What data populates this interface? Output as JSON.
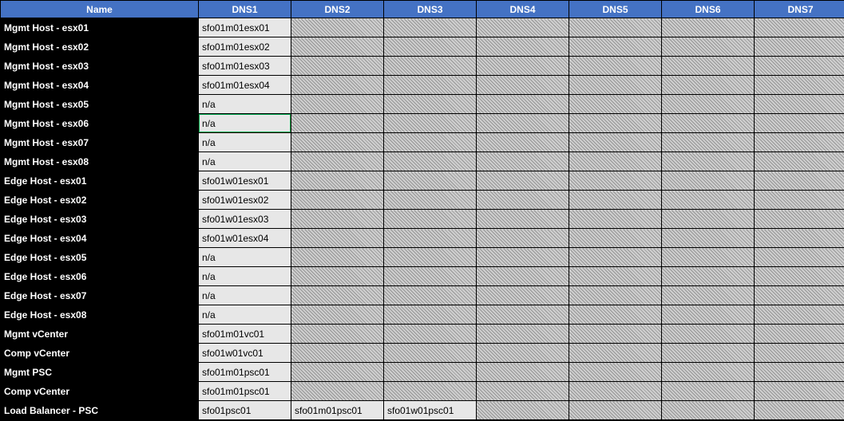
{
  "headers": {
    "name": "Name",
    "dns1": "DNS1",
    "dns2": "DNS2",
    "dns3": "DNS3",
    "dns4": "DNS4",
    "dns5": "DNS5",
    "dns6": "DNS6",
    "dns7": "DNS7"
  },
  "rows": [
    {
      "name": "Mgmt Host - esx01",
      "dns": [
        "sfo01m01esx01",
        null,
        null,
        null,
        null,
        null,
        null
      ]
    },
    {
      "name": "Mgmt Host - esx02",
      "dns": [
        "sfo01m01esx02",
        null,
        null,
        null,
        null,
        null,
        null
      ]
    },
    {
      "name": "Mgmt Host - esx03",
      "dns": [
        "sfo01m01esx03",
        null,
        null,
        null,
        null,
        null,
        null
      ]
    },
    {
      "name": "Mgmt Host - esx04",
      "dns": [
        "sfo01m01esx04",
        null,
        null,
        null,
        null,
        null,
        null
      ]
    },
    {
      "name": "Mgmt Host - esx05",
      "dns": [
        "n/a",
        null,
        null,
        null,
        null,
        null,
        null
      ]
    },
    {
      "name": "Mgmt Host - esx06",
      "dns": [
        "n/a",
        null,
        null,
        null,
        null,
        null,
        null
      ],
      "selected": 0
    },
    {
      "name": "Mgmt Host - esx07",
      "dns": [
        "n/a",
        null,
        null,
        null,
        null,
        null,
        null
      ]
    },
    {
      "name": "Mgmt Host - esx08",
      "dns": [
        "n/a",
        null,
        null,
        null,
        null,
        null,
        null
      ]
    },
    {
      "name": "Edge Host - esx01",
      "dns": [
        "sfo01w01esx01",
        null,
        null,
        null,
        null,
        null,
        null
      ]
    },
    {
      "name": "Edge Host - esx02",
      "dns": [
        "sfo01w01esx02",
        null,
        null,
        null,
        null,
        null,
        null
      ]
    },
    {
      "name": "Edge Host - esx03",
      "dns": [
        "sfo01w01esx03",
        null,
        null,
        null,
        null,
        null,
        null
      ]
    },
    {
      "name": "Edge Host - esx04",
      "dns": [
        "sfo01w01esx04",
        null,
        null,
        null,
        null,
        null,
        null
      ]
    },
    {
      "name": "Edge Host - esx05",
      "dns": [
        "n/a",
        null,
        null,
        null,
        null,
        null,
        null
      ]
    },
    {
      "name": "Edge Host - esx06",
      "dns": [
        "n/a",
        null,
        null,
        null,
        null,
        null,
        null
      ]
    },
    {
      "name": "Edge Host - esx07",
      "dns": [
        "n/a",
        null,
        null,
        null,
        null,
        null,
        null
      ]
    },
    {
      "name": "Edge Host - esx08",
      "dns": [
        "n/a",
        null,
        null,
        null,
        null,
        null,
        null
      ]
    },
    {
      "name": "Mgmt vCenter",
      "dns": [
        "sfo01m01vc01",
        null,
        null,
        null,
        null,
        null,
        null
      ]
    },
    {
      "name": "Comp vCenter",
      "dns": [
        "sfo01w01vc01",
        null,
        null,
        null,
        null,
        null,
        null
      ]
    },
    {
      "name": "Mgmt PSC",
      "dns": [
        "sfo01m01psc01",
        null,
        null,
        null,
        null,
        null,
        null
      ]
    },
    {
      "name": "Comp vCenter",
      "dns": [
        "sfo01m01psc01",
        null,
        null,
        null,
        null,
        null,
        null
      ]
    },
    {
      "name": "Load Balancer - PSC",
      "dns": [
        "sfo01psc01",
        "sfo01m01psc01",
        "sfo01w01psc01",
        null,
        null,
        null,
        null
      ]
    }
  ]
}
